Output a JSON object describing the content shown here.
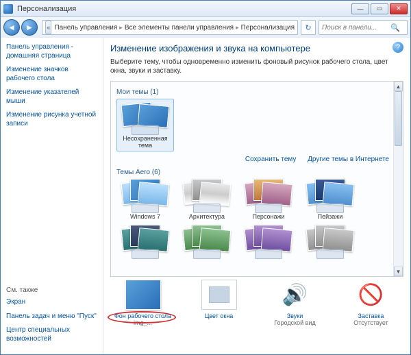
{
  "title": "Персонализация",
  "breadcrumb": {
    "items": [
      "Панель управления",
      "Все элементы панели управления",
      "Персонализация"
    ]
  },
  "search": {
    "placeholder": "Поиск в панели..."
  },
  "sidebar": {
    "links": [
      "Панель управления - домашняя страница",
      "Изменение значков рабочего стола",
      "Изменение указателей мыши",
      "Изменение рисунка учетной записи"
    ],
    "also_label": "См. также",
    "also_links": [
      "Экран",
      "Панель задач и меню \"Пуск\"",
      "Центр специальных возможностей"
    ]
  },
  "main": {
    "heading": "Изменение изображения и звука на компьютере",
    "desc": "Выберите тему, чтобы одновременно изменить фоновый рисунок рабочего стола, цвет окна, звуки и заставку.",
    "groups": [
      {
        "title": "Мои темы (1)",
        "items": [
          {
            "label": "Несохраненная тема",
            "selected": true
          }
        ],
        "footer": {
          "save": "Сохранить тему",
          "more": "Другие темы в Интернете"
        }
      },
      {
        "title": "Темы Aero (6)",
        "items": [
          {
            "label": "Windows 7"
          },
          {
            "label": "Архитектура"
          },
          {
            "label": "Персонажи"
          },
          {
            "label": "Пейзажи"
          },
          {
            "label": ""
          },
          {
            "label": ""
          },
          {
            "label": ""
          },
          {
            "label": ""
          }
        ]
      }
    ],
    "quick": [
      {
        "label": "Фон рабочего стола",
        "sub": "img_...",
        "highlight": true
      },
      {
        "label": "Цвет окна",
        "sub": ""
      },
      {
        "label": "Звуки",
        "sub": "Городской вид"
      },
      {
        "label": "Заставка",
        "sub": "Отсутствует"
      }
    ]
  }
}
